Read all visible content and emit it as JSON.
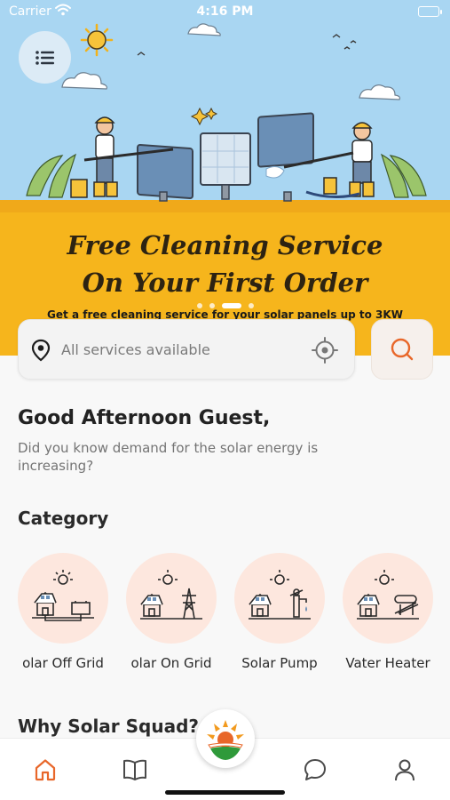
{
  "status_bar": {
    "carrier": "Carrier",
    "time": "4:16 PM"
  },
  "banner": {
    "title_line1": "Free Cleaning Service",
    "title_line2": "On Your First Order",
    "subtitle": "Get a free cleaning service for your solar panels up to 3KW",
    "slides_count": 4,
    "active_slide": 3
  },
  "search": {
    "placeholder": "All services available"
  },
  "greeting": {
    "title": "Good Afternoon Guest,",
    "subtitle": "Did you know demand for the solar energy is increasing?"
  },
  "category": {
    "title": "Category",
    "items": [
      {
        "label": "olar Off Grid",
        "icon": "off-grid-house-battery-icon"
      },
      {
        "label": "olar On Grid",
        "icon": "on-grid-house-tower-icon"
      },
      {
        "label": "Solar Pump",
        "icon": "solar-pump-icon"
      },
      {
        "label": "Vater Heater",
        "icon": "water-heater-icon"
      }
    ]
  },
  "why_section": {
    "title": "Why Solar Squad?"
  },
  "tabbar": {
    "items": [
      {
        "name": "home",
        "icon": "home-icon",
        "active": true
      },
      {
        "name": "catalog",
        "icon": "book-icon",
        "active": false
      },
      {
        "name": "chat",
        "icon": "chat-icon",
        "active": false
      },
      {
        "name": "profile",
        "icon": "user-icon",
        "active": false
      }
    ]
  },
  "colors": {
    "accent": "#e8672a",
    "banner_yellow": "#f6b51c",
    "sky": "#a9d6f2",
    "category_bg": "#fde7de"
  }
}
